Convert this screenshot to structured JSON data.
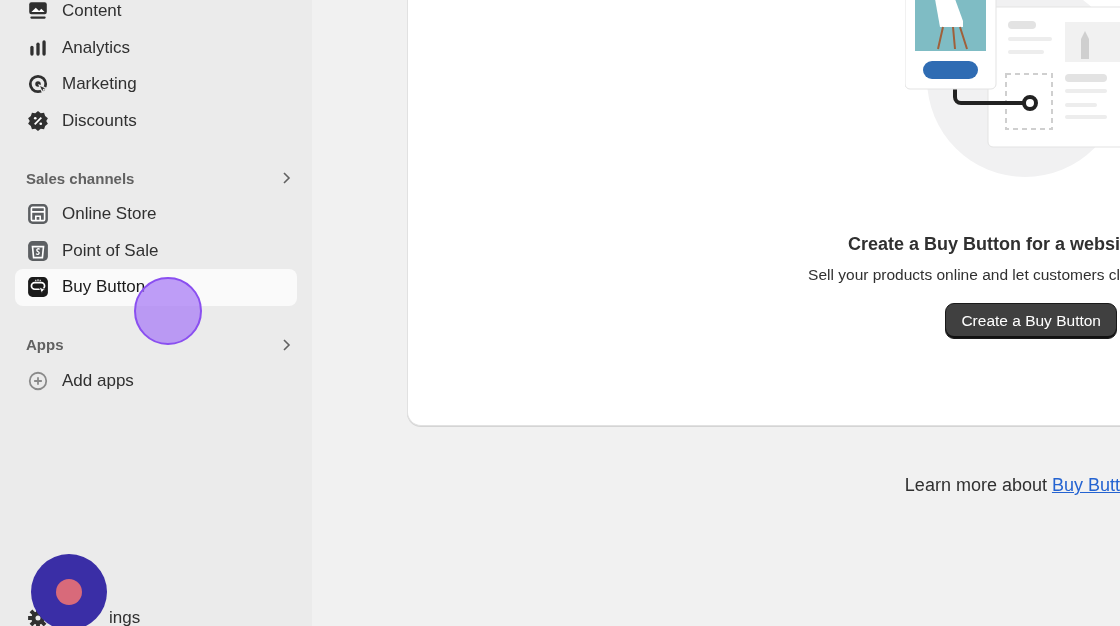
{
  "sidebar": {
    "items": [
      {
        "label": "Content",
        "kind": "content",
        "selected": false
      },
      {
        "label": "Analytics",
        "kind": "bars",
        "selected": false
      },
      {
        "label": "Marketing",
        "kind": "target",
        "selected": false
      },
      {
        "label": "Discounts",
        "kind": "discount",
        "selected": false
      }
    ],
    "sections": [
      {
        "title": "Sales channels",
        "items": [
          {
            "label": "Online Store",
            "kind": "store",
            "selected": false
          },
          {
            "label": "Point of Sale",
            "kind": "pos",
            "selected": false
          },
          {
            "label": "Buy Button",
            "kind": "buybutton",
            "selected": true
          }
        ]
      },
      {
        "title": "Apps",
        "items": [
          {
            "label": "Add apps",
            "kind": "plus",
            "selected": false
          }
        ]
      }
    ],
    "settings": {
      "label": "ings",
      "kind": "gear"
    }
  },
  "card": {
    "heading": "Create a Buy Button for a websi",
    "text": "Sell your products online and let customers cl",
    "button": "Create a Buy Button"
  },
  "footer": {
    "text": "Learn more about ",
    "link": "Buy Butt"
  }
}
